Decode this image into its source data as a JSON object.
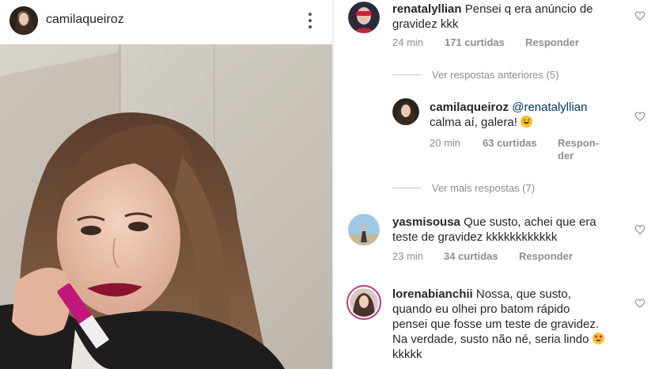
{
  "post": {
    "username": "camilaqueiroz"
  },
  "comments": [
    {
      "username": "renatalyllian",
      "text_line1": "Pensei q era anúncio de",
      "text_line2": "gravidez kkk",
      "time": "24 min",
      "likes": "171 curtidas",
      "reply": "Responder"
    },
    {
      "view_previous": "Ver respostas anteriores (5)"
    },
    {
      "username": "camilaqueiroz",
      "mention": "@renatalyllian",
      "text_line2": "calma aí, galera!",
      "emoji": "grinning-sweat",
      "time": "20 min",
      "likes": "63 curtidas",
      "reply_line1": "Respon-",
      "reply_line2": "der"
    },
    {
      "view_more": "Ver mais respostas (7)"
    },
    {
      "username": "yasmisousa",
      "text_line1": "Que susto, achei que era",
      "text_line2": "teste de gravidez kkkkkkkkkkkk",
      "time": "23 min",
      "likes": "34 curtidas",
      "reply": "Responder"
    },
    {
      "username": "lorenabianchii",
      "text_line1": "Nossa, que susto,",
      "text_line2": "quando eu olhei pro batom rápido",
      "text_line3": "pensei que fosse um teste de gravidez.",
      "text_line4": "Na verdade, susto não né, seria lindo",
      "text_line5": "kkkkk",
      "emoji": "heart-eyes"
    }
  ],
  "colors": {
    "text": "#262626",
    "meta": "#8e8e8e",
    "story_ring": "#c13584"
  }
}
